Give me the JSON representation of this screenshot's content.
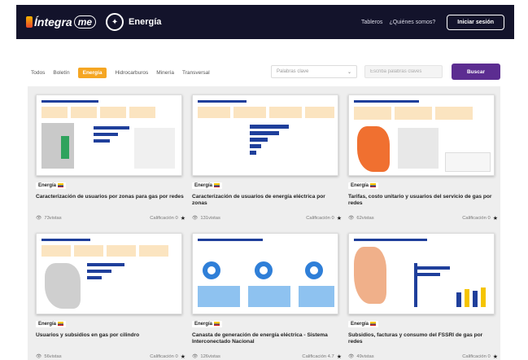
{
  "header": {
    "logo_text": "Íntegra",
    "logo_me": "me",
    "brand": "Energía",
    "nav": [
      "Tableros",
      "¿Quiénes somos?"
    ],
    "login_label": "Iniciar sesión"
  },
  "filters": {
    "chips": [
      "Todos",
      "Boletín",
      "Energía",
      "Hidrocarburos",
      "Minería",
      "Transversal"
    ],
    "active": "Energía",
    "keywords_select": "Palabras clave",
    "search_placeholder": "Escriba palabras claves",
    "search_label": "Buscar"
  },
  "cards": [
    {
      "tag": "Energía",
      "title": "Caracterización de usuarios por zonas para gas por redes",
      "views": "73vistas",
      "rating": "Calificación 0"
    },
    {
      "tag": "Energía",
      "title": "Caracterización de usuarios de energía eléctrica por zonas",
      "views": "131vistas",
      "rating": "Calificación 0"
    },
    {
      "tag": "Energía",
      "title": "Tarifas, costo unitario y usuarios del servicio de gas por redes",
      "views": "62vistas",
      "rating": "Calificación 0"
    },
    {
      "tag": "Energía",
      "title": "Usuarios y subsidios en gas por cilindro",
      "views": "56vistas",
      "rating": "Calificación 0"
    },
    {
      "tag": "Energía",
      "title": "Canasta de generación de energía eléctrica - Sistema Interconectado Nacional",
      "views": "126vistas",
      "rating": "Calificación 4.7"
    },
    {
      "tag": "Energía",
      "title": "Subsidios, facturas y consumo del FSSRI de gas por redes",
      "views": "49vistas",
      "rating": "Calificación 0"
    }
  ],
  "colors": {
    "header_bg": "#13132b",
    "accent": "#f5a623",
    "primary": "#5c2d91"
  }
}
